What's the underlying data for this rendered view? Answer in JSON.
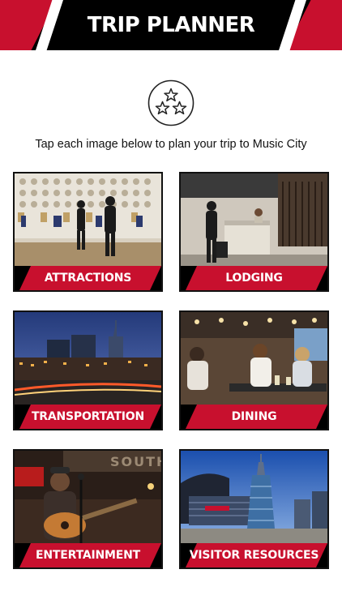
{
  "header": {
    "title": "TRIP PLANNER"
  },
  "logo": {
    "icon": "three-stars-icon"
  },
  "instruction": "Tap each image below to plan your trip to Music City",
  "tiles": [
    {
      "label": "ATTRACTIONS"
    },
    {
      "label": "LODGING"
    },
    {
      "label": "TRANSPORTATION"
    },
    {
      "label": "DINING"
    },
    {
      "label": "ENTERTAINMENT"
    },
    {
      "label": "VISITOR RESOURCES"
    }
  ],
  "photo_signs": {
    "entertainment_sign": "SOUTH"
  },
  "colors": {
    "accent_red": "#c8102e",
    "header_black": "#000000"
  }
}
